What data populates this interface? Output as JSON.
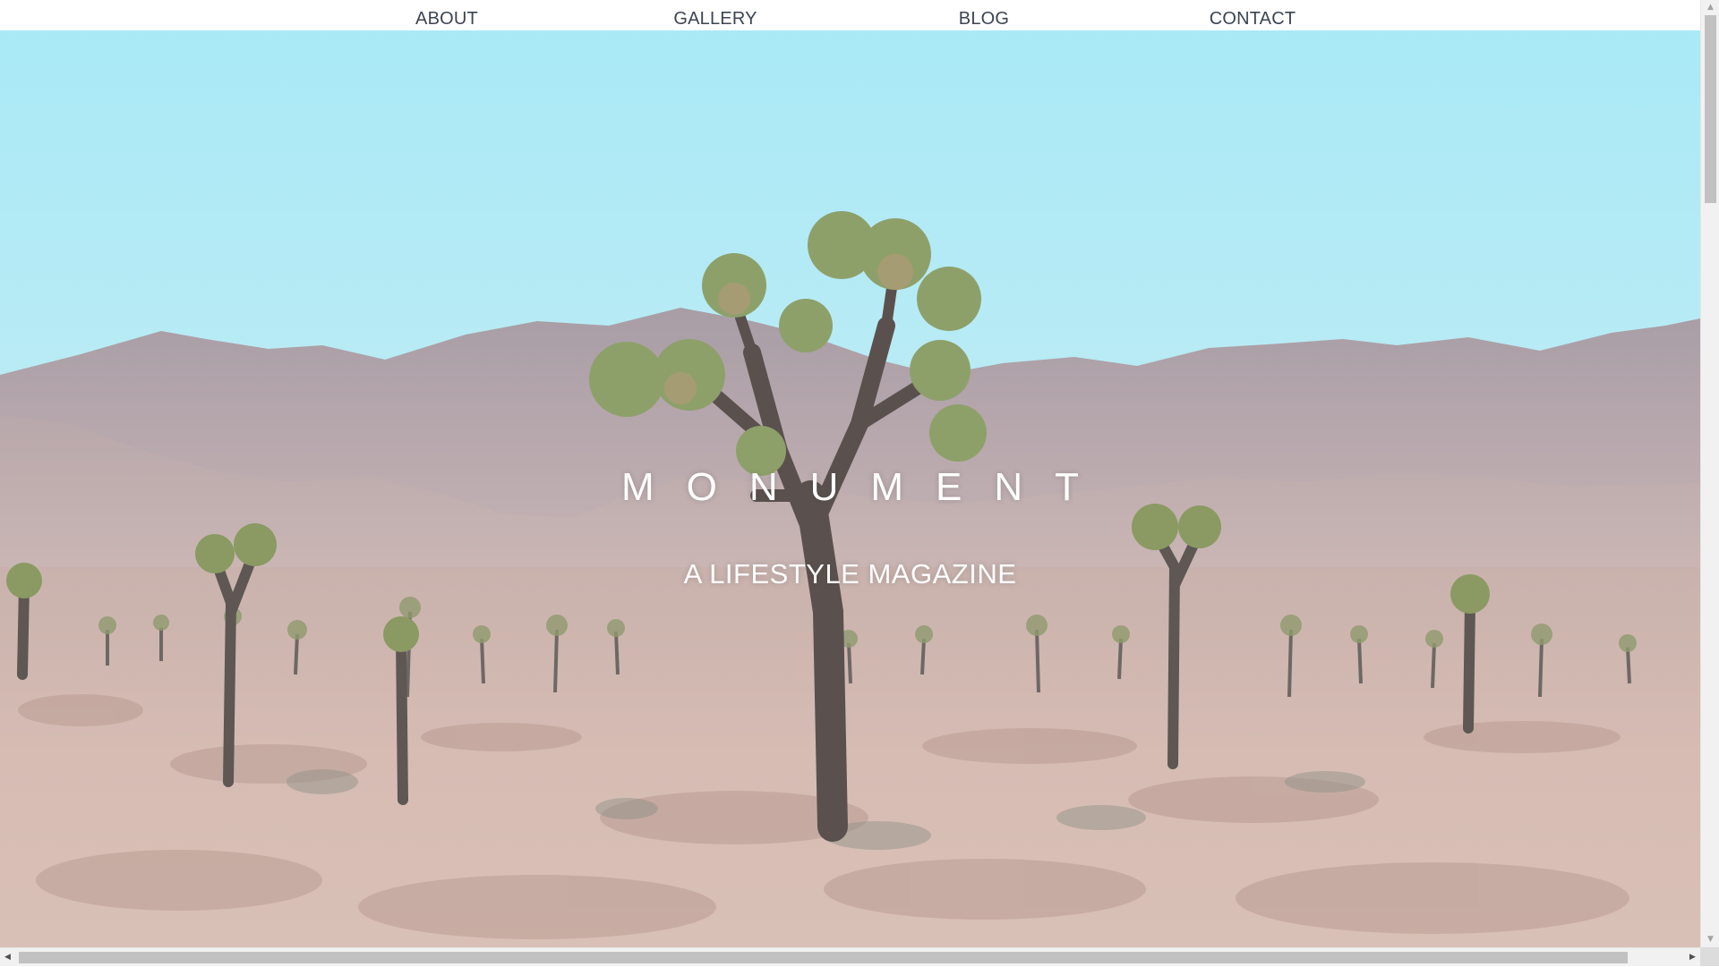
{
  "nav": {
    "items": [
      {
        "label": "ABOUT"
      },
      {
        "label": "GALLERY"
      },
      {
        "label": "BLOG"
      },
      {
        "label": "CONTACT"
      }
    ]
  },
  "hero": {
    "title": "MONUMENT",
    "subtitle": "A LIFESTYLE MAGAZINE",
    "image": "desert-joshua-tree-landscape"
  },
  "colors": {
    "nav_text": "#3b4452",
    "sky_top": "#a9e9f6",
    "sky_bottom": "#cdeff4",
    "mountains": "#b9a7ad",
    "ground": "#d4b8b0",
    "hero_text": "#ffffff"
  },
  "scrollbars": {
    "vertical": {
      "up_icon": "triangle-up-icon",
      "down_icon": "triangle-down-icon"
    },
    "horizontal": {
      "left_icon": "triangle-left-icon",
      "right_icon": "triangle-right-icon"
    }
  }
}
